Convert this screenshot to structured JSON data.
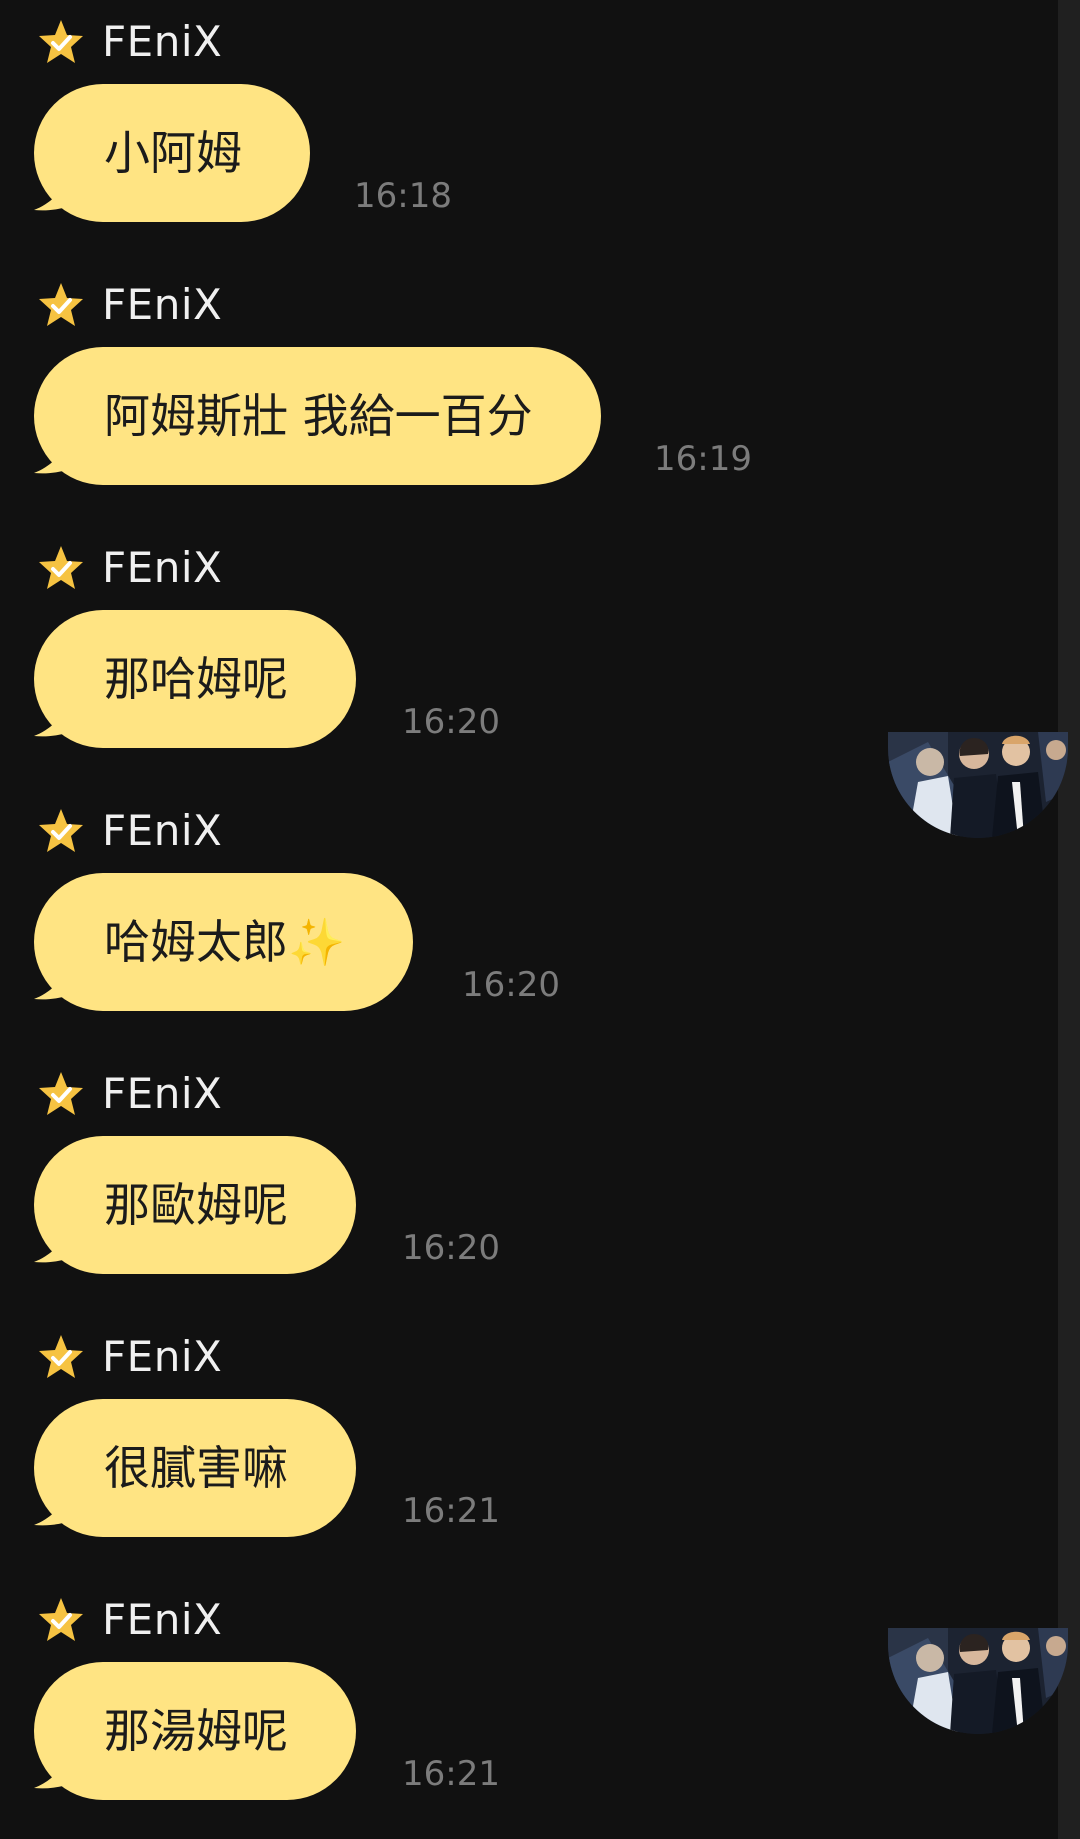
{
  "chat": {
    "messages": [
      {
        "sender": "FEniX",
        "text": "小阿姆",
        "time": "16:18"
      },
      {
        "sender": "FEniX",
        "text": "阿姆斯壯 我給一百分",
        "time": "16:19"
      },
      {
        "sender": "FEniX",
        "text": "那哈姆呢",
        "time": "16:20"
      },
      {
        "sender": "FEniX",
        "text": "哈姆太郎✨",
        "time": "16:20"
      },
      {
        "sender": "FEniX",
        "text": "那歐姆呢",
        "time": "16:20"
      },
      {
        "sender": "FEniX",
        "text": "很膩害嘛",
        "time": "16:21"
      },
      {
        "sender": "FEniX",
        "text": "那湯姆呢",
        "time": "16:21"
      }
    ]
  },
  "theme": {
    "background": "#111111",
    "bubble": "#ffe483",
    "star": "#f6c342",
    "timestamp": "#7c7c7c"
  },
  "icons": {
    "sender_badge": "star-check-icon",
    "avatar": "group-photo-avatar"
  }
}
